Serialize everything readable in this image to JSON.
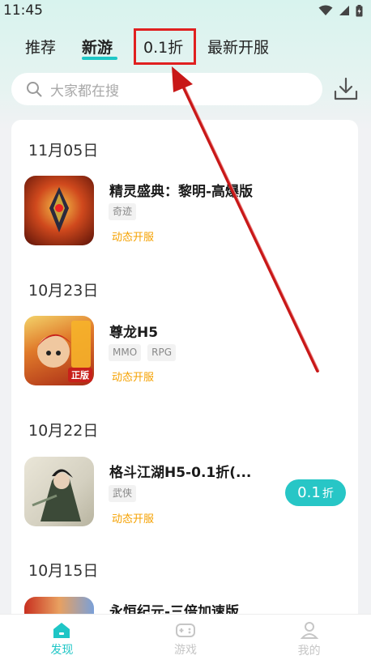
{
  "status_bar": {
    "time": "11:45"
  },
  "tabs": [
    {
      "label": "推荐"
    },
    {
      "label": "新游"
    },
    {
      "label": "0.1折"
    },
    {
      "label": "最新开服"
    }
  ],
  "search": {
    "placeholder": "大家都在搜"
  },
  "sections": [
    {
      "date": "11月05日",
      "game": {
        "title": "精灵盛典：黎明-高爆版",
        "tags": [
          "奇迹"
        ],
        "status": "动态开服"
      }
    },
    {
      "date": "10月23日",
      "game": {
        "title": "尊龙H5",
        "tags": [
          "MMO",
          "RPG"
        ],
        "status": "动态开服",
        "icon_badge": "正版"
      }
    },
    {
      "date": "10月22日",
      "game": {
        "title": "格斗江湖H5-0.1折(...",
        "tags": [
          "武侠"
        ],
        "status": "动态开服",
        "discount": "0.1",
        "discount_unit": "折"
      }
    },
    {
      "date": "10月15日",
      "game": {
        "title": "永恒纪元-三倍加速版"
      }
    }
  ],
  "bottom_nav": [
    {
      "label": "发现",
      "icon": "home-icon"
    },
    {
      "label": "游戏",
      "icon": "gamepad-icon"
    },
    {
      "label": "我的",
      "icon": "user-icon"
    }
  ],
  "colors": {
    "accent": "#1fc6c6",
    "annotation": "#e02020",
    "status_text": "#f5a100"
  }
}
